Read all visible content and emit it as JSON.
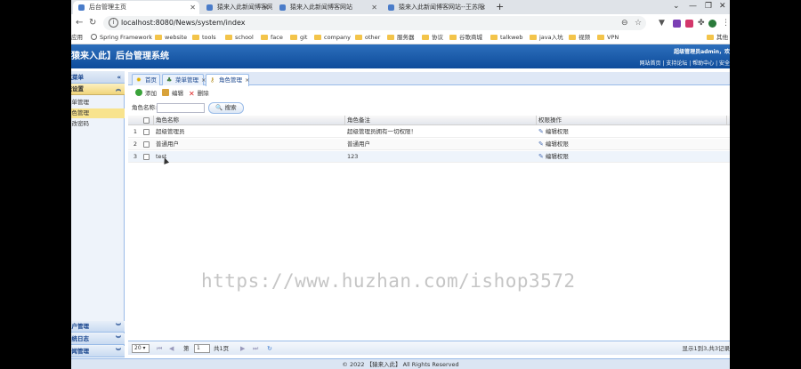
{
  "browser": {
    "tabs": [
      {
        "title": "后台管理主页",
        "active": true
      },
      {
        "title": "猿来入此新闻博客网站"
      },
      {
        "title": "猿来入此新闻博客网站"
      },
      {
        "title": "猿来入此新闻博客网站--王苏阳"
      }
    ],
    "new_tab": "+",
    "url": "localhost:8080/News/system/index",
    "bookmarks": [
      {
        "label": "应用",
        "kind": "apps"
      },
      {
        "label": "Spring Framework",
        "kind": "globe"
      },
      {
        "label": "website",
        "kind": "folder"
      },
      {
        "label": "tools",
        "kind": "folder"
      },
      {
        "label": "school",
        "kind": "folder"
      },
      {
        "label": "face",
        "kind": "folder"
      },
      {
        "label": "git",
        "kind": "folder"
      },
      {
        "label": "company",
        "kind": "folder"
      },
      {
        "label": "other",
        "kind": "folder"
      },
      {
        "label": "服务器",
        "kind": "folder"
      },
      {
        "label": "协议",
        "kind": "folder"
      },
      {
        "label": "谷歌商城",
        "kind": "folder"
      },
      {
        "label": "talkweb",
        "kind": "folder"
      },
      {
        "label": "java入坑",
        "kind": "folder"
      },
      {
        "label": "视频",
        "kind": "folder"
      },
      {
        "label": "VPN",
        "kind": "folder"
      },
      {
        "label": "其他",
        "kind": "folder"
      }
    ]
  },
  "header": {
    "title": "猿来入此】后台管理系统",
    "welcome": "超级管理员admin，欢",
    "links": "网站首页 | 支持论坛 | 帮助中心 | 安全"
  },
  "sidebar": {
    "title": "导航菜单",
    "collapse": "«",
    "sections": [
      {
        "label": "系统设置",
        "expanded": true
      },
      {
        "label": "用户管理"
      },
      {
        "label": "系统日志"
      },
      {
        "label": "新闻管理"
      }
    ],
    "items": [
      {
        "label": "菜单管理"
      },
      {
        "label": "角色管理",
        "selected": true
      },
      {
        "label": "修改密码"
      }
    ]
  },
  "content_tabs": [
    {
      "label": "首页",
      "icon": "bulb-icon"
    },
    {
      "label": "菜单管理",
      "icon": "tree-icon",
      "closable": true
    },
    {
      "label": "角色管理",
      "icon": "key-icon",
      "closable": true,
      "active": true
    }
  ],
  "toolbar": {
    "add": "添加",
    "edit": "编辑",
    "delete": "删除"
  },
  "search": {
    "label": "角色名称:",
    "value": "",
    "button": "搜索"
  },
  "grid": {
    "columns": [
      "角色名称",
      "角色备注",
      "权限操作"
    ],
    "rows": [
      {
        "num": "1",
        "name": "超级管理员",
        "remark": "超级管理员拥有一切权限！",
        "action": "编辑权限"
      },
      {
        "num": "2",
        "name": "普通用户",
        "remark": "普通用户",
        "action": "编辑权限"
      },
      {
        "num": "3",
        "name": "test",
        "remark": "123",
        "action": "编辑权限"
      }
    ]
  },
  "pager": {
    "page_size": "20",
    "page_prefix": "第",
    "page_value": "1",
    "page_suffix": "共1页",
    "info": "显示1到3,共3记录"
  },
  "footer": "© 2022 【猿来入此】 All Rights Reserved",
  "watermark": "https://www.huzhan.com/ishop3572"
}
